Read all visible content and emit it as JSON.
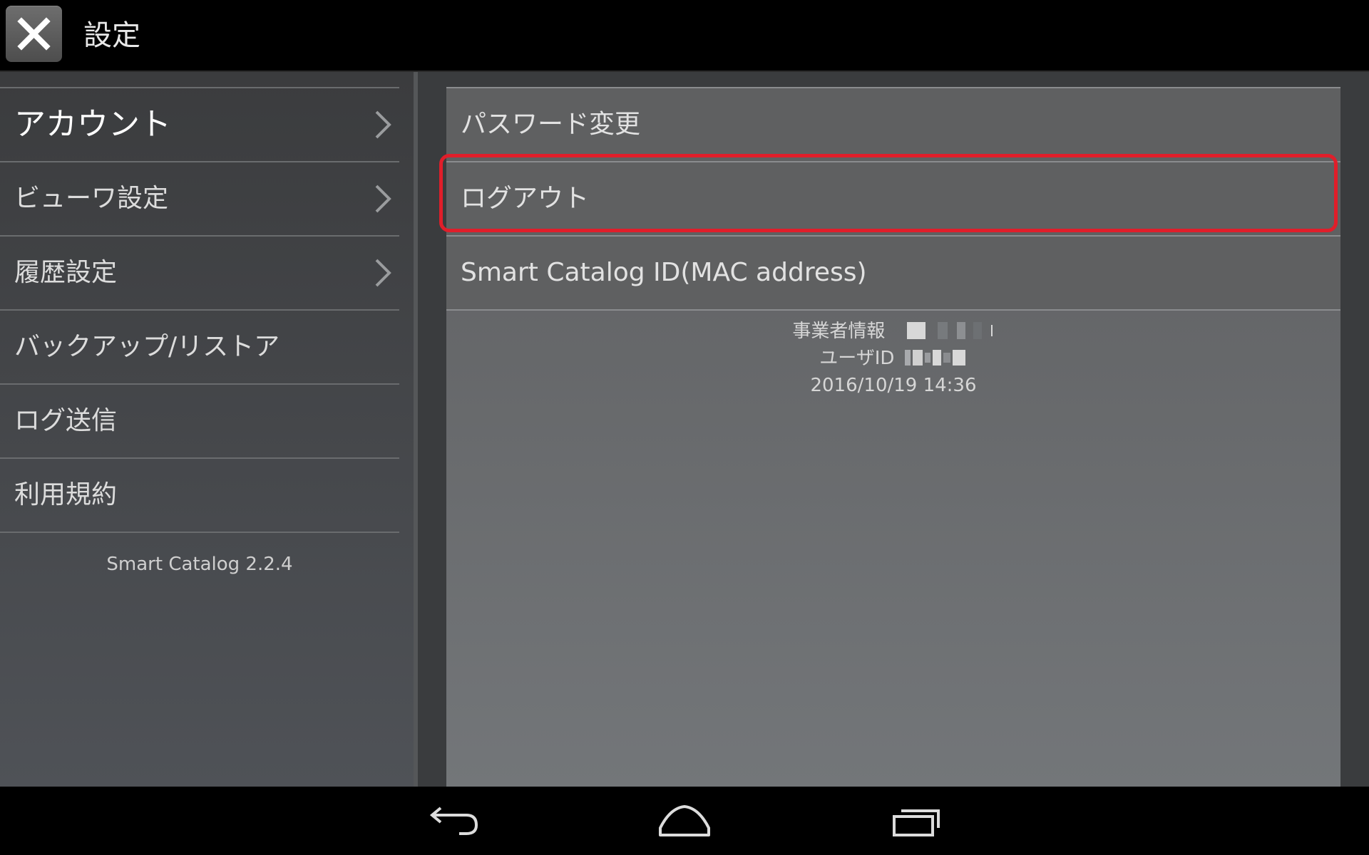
{
  "topbar": {
    "title": "設定",
    "close_icon": "close-icon"
  },
  "sidebar": {
    "items": [
      {
        "label": "アカウント",
        "selected": true,
        "has_chevron": true
      },
      {
        "label": "ビューワ設定",
        "selected": false,
        "has_chevron": true
      },
      {
        "label": "履歴設定",
        "selected": false,
        "has_chevron": true
      },
      {
        "label": "バックアップ/リストア",
        "selected": false,
        "has_chevron": false
      },
      {
        "label": "ログ送信",
        "selected": false,
        "has_chevron": false
      },
      {
        "label": "利用規約",
        "selected": false,
        "has_chevron": false
      }
    ],
    "version": "Smart Catalog 2.2.4"
  },
  "detail": {
    "items": [
      {
        "label": "パスワード変更"
      },
      {
        "label": "ログアウト",
        "highlighted": true
      },
      {
        "label": "Smart Catalog ID(MAC address)"
      }
    ],
    "info": {
      "business_label": "事業者情報",
      "user_id_label": "ユーザID",
      "timestamp": "2016/10/19 14:36"
    }
  },
  "colors": {
    "highlight": "#e01e2a",
    "topbar_bg": "#000000",
    "sidebar_text": "#dcdcdc"
  },
  "navbar": {
    "icons": [
      "back-icon",
      "home-icon",
      "recent-apps-icon"
    ]
  }
}
